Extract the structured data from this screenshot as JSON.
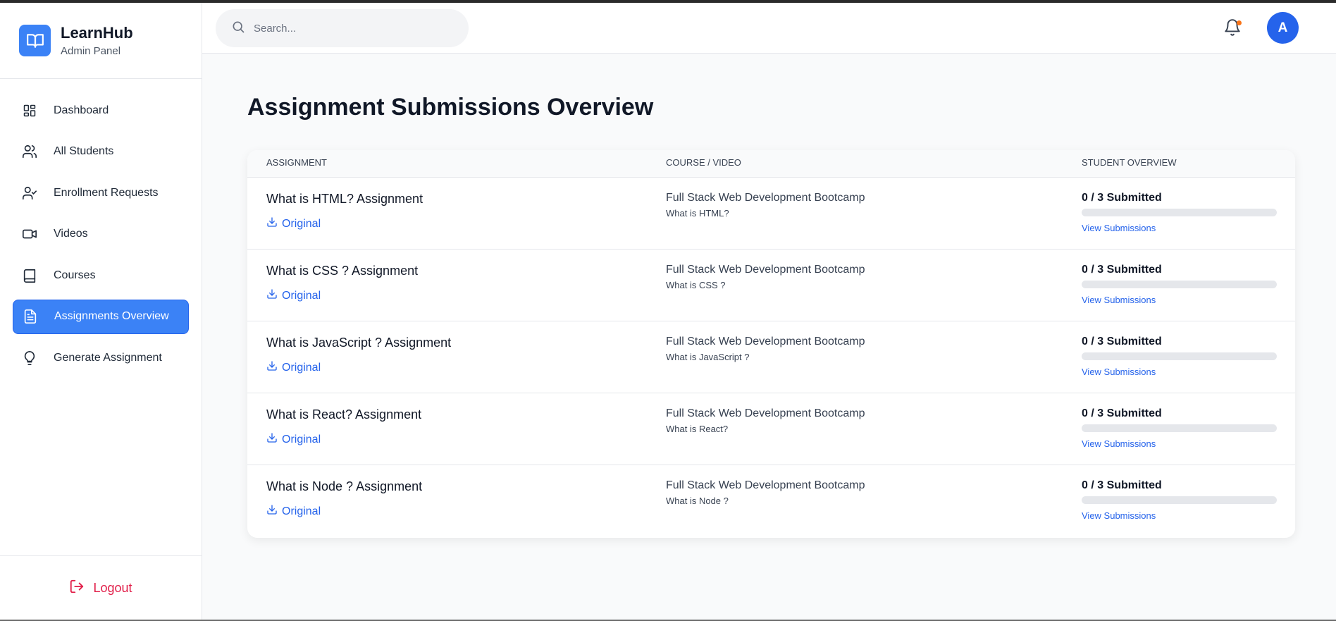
{
  "brand": {
    "title": "LearnHub",
    "subtitle": "Admin Panel"
  },
  "sidebar": {
    "items": [
      {
        "label": "Dashboard",
        "icon": "dashboard-icon",
        "active": false
      },
      {
        "label": "All Students",
        "icon": "users-icon",
        "active": false
      },
      {
        "label": "Enrollment Requests",
        "icon": "user-check-icon",
        "active": false
      },
      {
        "label": "Videos",
        "icon": "video-icon",
        "active": false
      },
      {
        "label": "Courses",
        "icon": "book-icon",
        "active": false
      },
      {
        "label": "Assignments Overview",
        "icon": "file-text-icon",
        "active": true
      },
      {
        "label": "Generate Assignment",
        "icon": "lightbulb-icon",
        "active": false
      }
    ],
    "logout_label": "Logout"
  },
  "header": {
    "search_placeholder": "Search...",
    "avatar_initial": "A",
    "notification_dot_color": "#f97316"
  },
  "main": {
    "title": "Assignment Submissions Overview",
    "table": {
      "columns": [
        "ASSIGNMENT",
        "COURSE / VIDEO",
        "STUDENT OVERVIEW"
      ],
      "rows": [
        {
          "assignment": "What is HTML? Assignment",
          "link": "Original",
          "course": "Full Stack Web Development Bootcamp",
          "video": "What is HTML?",
          "submitted": "0 / 3 Submitted",
          "progress": 0,
          "view": "View Submissions"
        },
        {
          "assignment": "What is CSS ? Assignment",
          "link": "Original",
          "course": "Full Stack Web Development Bootcamp",
          "video": "What is CSS ?",
          "submitted": "0 / 3 Submitted",
          "progress": 0,
          "view": "View Submissions"
        },
        {
          "assignment": "What is JavaScript ? Assignment",
          "link": "Original",
          "course": "Full Stack Web Development Bootcamp",
          "video": "What is JavaScript ?",
          "submitted": "0 / 3 Submitted",
          "progress": 0,
          "view": "View Submissions"
        },
        {
          "assignment": "What is React? Assignment",
          "link": "Original",
          "course": "Full Stack Web Development Bootcamp",
          "video": "What is React?",
          "submitted": "0 / 3 Submitted",
          "progress": 0,
          "view": "View Submissions"
        },
        {
          "assignment": "What is Node ? Assignment",
          "link": "Original",
          "course": "Full Stack Web Development Bootcamp",
          "video": "What is Node ?",
          "submitted": "0 / 3 Submitted",
          "progress": 0,
          "view": "View Submissions"
        }
      ]
    }
  },
  "colors": {
    "accent": "#3b82f6",
    "link": "#2563eb",
    "logout": "#e11d48"
  }
}
